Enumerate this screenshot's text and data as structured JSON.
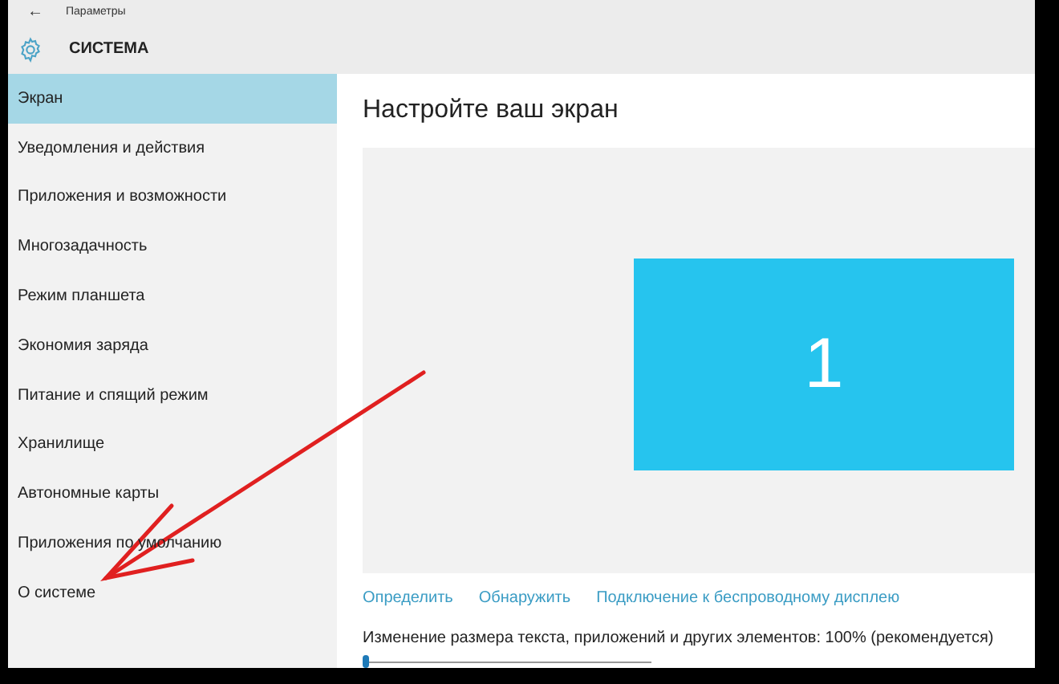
{
  "window": {
    "title": "Параметры",
    "back": "←"
  },
  "header": {
    "title": "СИСТЕМА"
  },
  "sidebar": {
    "items": [
      {
        "label": "Экран",
        "selected": true
      },
      {
        "label": "Уведомления и действия",
        "selected": false
      },
      {
        "label": "Приложения и возможности",
        "selected": false
      },
      {
        "label": "Многозадачность",
        "selected": false
      },
      {
        "label": "Режим планшета",
        "selected": false
      },
      {
        "label": "Экономия заряда",
        "selected": false
      },
      {
        "label": "Питание и спящий режим",
        "selected": false
      },
      {
        "label": "Хранилище",
        "selected": false
      },
      {
        "label": "Автономные карты",
        "selected": false
      },
      {
        "label": "Приложения по умолчанию",
        "selected": false
      },
      {
        "label": "О системе",
        "selected": false
      }
    ]
  },
  "content": {
    "heading": "Настройте ваш экран",
    "monitor": {
      "label": "1"
    },
    "links": [
      "Определить",
      "Обнаружить",
      "Подключение к беспроводному дисплею"
    ],
    "scale": {
      "label": "Изменение размера текста, приложений и других элементов: 100% (рекомендуется)",
      "level": 0
    }
  }
}
